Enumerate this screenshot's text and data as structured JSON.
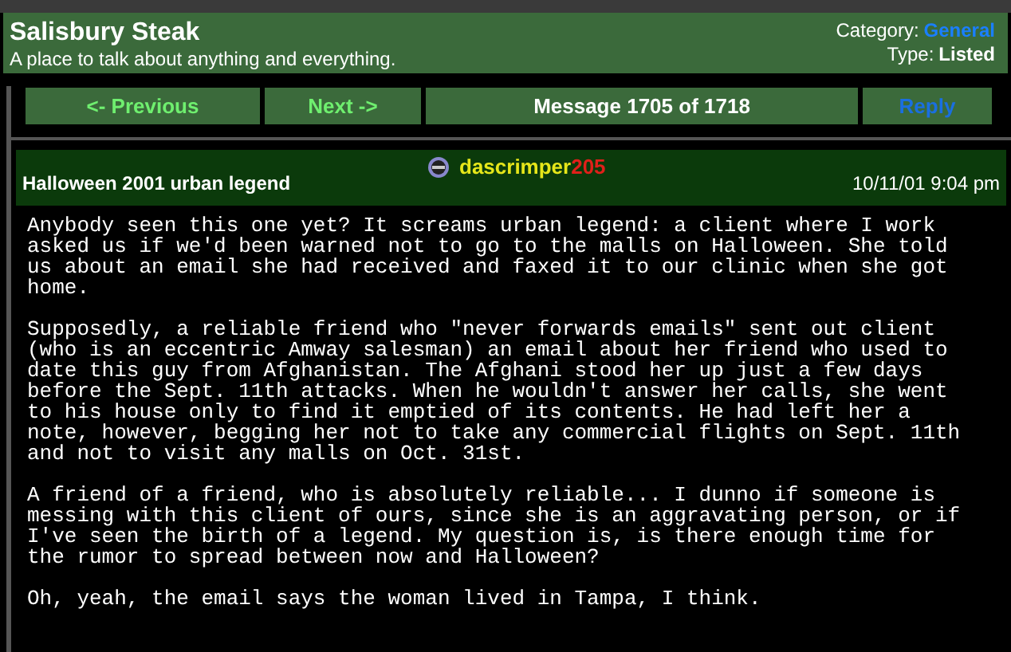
{
  "board": {
    "title": "Salisbury Steak",
    "subtitle": "A place to talk about anything and everything.",
    "category_label": "Category:",
    "category": "General",
    "type_label": "Type:",
    "type": "Listed"
  },
  "nav": [
    {
      "kind": "link",
      "label": "<- Previous"
    },
    {
      "kind": "link",
      "label": "Next ->"
    },
    {
      "kind": "info",
      "label": "Message 1705 of 1718"
    },
    {
      "kind": "action",
      "label": "Reply"
    }
  ],
  "message": {
    "subject": "Halloween 2001 urban legend",
    "author_name": "dascrimper",
    "author_number": "205",
    "date": "10/11/01 9:04 pm",
    "paragraphs": [
      {
        "lines": [
          "Anybody seen this one yet? It screams urban legend: a client where I work",
          "asked us if we'd been warned not to go to the malls on Halloween. She told",
          "us about an email she had received and faxed it to our clinic when she got",
          "home."
        ]
      },
      {
        "lines": [
          "Supposedly, a reliable friend who \"never forwards emails\" sent out client",
          "(who is an eccentric Amway salesman) an email about her friend who used to",
          "date this guy from Afghanistan. The Afghani stood her up just a few days",
          "before the Sept. 11th attacks. When he wouldn't answer her calls, she went",
          "to his house only to find it emptied of its contents. He had left her a",
          "note, however, begging her not to take any commercial flights on Sept. 11th",
          "and not to visit any malls on Oct. 31st."
        ]
      },
      {
        "lines": [
          "A friend of a friend, who is absolutely reliable... I dunno if someone is",
          "messing with this client of ours, since she is an aggravating person, or if",
          "I've seen the birth of a legend. My question is, is there enough time for",
          "the rumor to spread between now and Halloween?"
        ]
      },
      {
        "lines": [
          "Oh, yeah, the email says the woman lived in Tampa, I think."
        ]
      }
    ]
  }
}
